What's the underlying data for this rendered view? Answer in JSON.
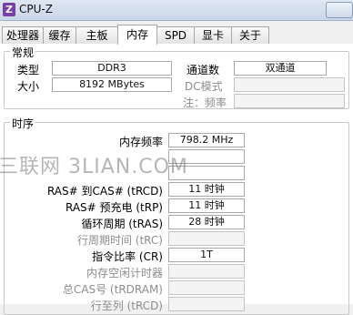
{
  "window": {
    "title": "CPU-Z",
    "icon_text": "Z"
  },
  "tabs": [
    {
      "label": "处理器"
    },
    {
      "label": "缓存"
    },
    {
      "label": "主板"
    },
    {
      "label": "内存",
      "active": true
    },
    {
      "label": "SPD"
    },
    {
      "label": "显卡"
    },
    {
      "label": "关于"
    }
  ],
  "general": {
    "title": "常规",
    "type_label": "类型",
    "type_value": "DDR3",
    "size_label": "大小",
    "size_value": "8192 MBytes",
    "channels_label": "通道数",
    "channels_value": "双通道",
    "dc_mode_label": "DC模式",
    "dc_mode_value": "",
    "nb_freq_label": "注：频率",
    "nb_freq_value": ""
  },
  "timings": {
    "title": "时序",
    "dram_freq_label": "内存频率",
    "dram_freq_value": "798.2 MHz",
    "row2_value": "",
    "row3_value": "",
    "trcd_label": "RAS# 到CAS# (tRCD)",
    "trcd_value": "11 时钟",
    "trp_label": "RAS# 预充电 (tRP)",
    "trp_value": "11 时钟",
    "tras_label": "循环周期 (tRAS)",
    "tras_value": "28 时钟",
    "trc_label": "行周期时间 (tRC)",
    "trc_value": "",
    "cr_label": "指令比率 (CR)",
    "cr_value": "1T",
    "idle_timer_label": "内存空闲计时器",
    "idle_timer_value": "",
    "trdram_label": "总CAS号 (tRDRAM)",
    "trdram_value": "",
    "trcd2_label": "行至列 (tRCD)",
    "trcd2_value": ""
  },
  "watermark": "三联网 3LIAN.COM"
}
